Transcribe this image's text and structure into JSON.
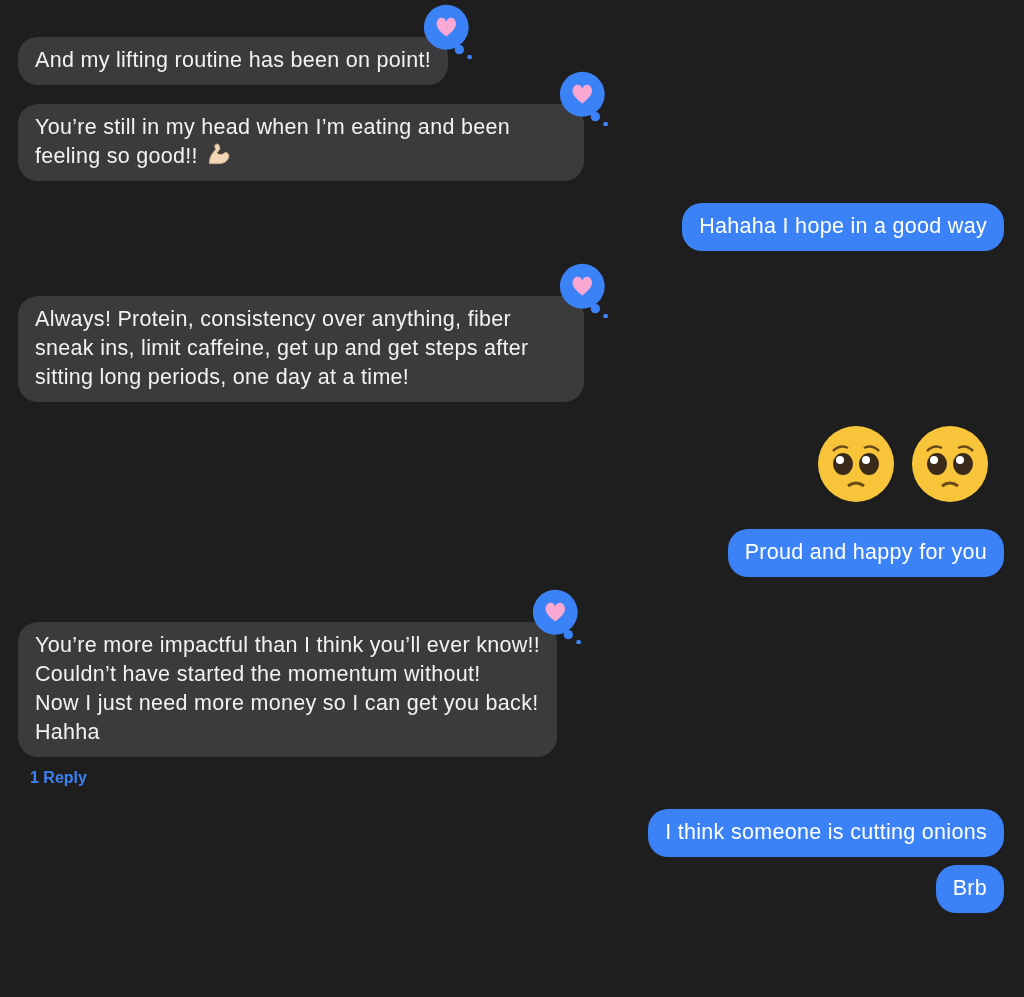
{
  "messages": [
    {
      "sent": false,
      "kind": "text",
      "text": "And my lifting routine has been on point!",
      "hearted": true
    },
    {
      "sent": false,
      "kind": "text-with-arm",
      "text": "You’re still in my head when I’m eating and been feeling so good!!",
      "hearted": true
    },
    {
      "sent": true,
      "kind": "text",
      "text": "Hahaha I hope in a good way",
      "hearted": false
    },
    {
      "sent": false,
      "kind": "text",
      "text": "Always! Protein, consistency over anything, fiber sneak ins, limit caffeine, get up and get steps after sitting long periods, one day at a time!",
      "hearted": true
    },
    {
      "sent": true,
      "kind": "emoji",
      "emojis": [
        {
          "kind": "pleading-face"
        },
        {
          "kind": "pleading-face"
        }
      ],
      "hearted": false
    },
    {
      "sent": true,
      "kind": "text",
      "text": "Proud and happy for you",
      "hearted": false
    },
    {
      "sent": false,
      "kind": "text",
      "text": "You’re more impactful than I think you’ll ever know!!\nCouldn’t have started the momentum without!\nNow I just need more money so I can get you back!\nHahha",
      "hearted": true,
      "reply_link": "1 Reply"
    },
    {
      "sent": true,
      "kind": "text",
      "text": "I think someone is cutting onions",
      "hearted": false
    },
    {
      "sent": true,
      "kind": "text",
      "text": "Brb",
      "hearted": false
    }
  ]
}
